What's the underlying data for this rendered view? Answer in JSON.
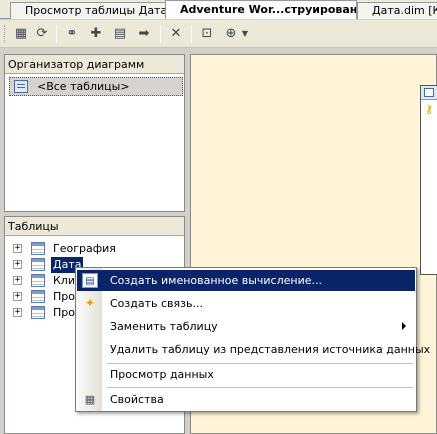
{
  "tabs": [
    {
      "label": "Просмотр таблицы Дата"
    },
    {
      "label": "Adventure Wor...струирование]"
    },
    {
      "label": "Дата.dim [Ко"
    }
  ],
  "diagram_pane": {
    "title": "Организатор диаграмм",
    "item": "<Все таблицы>"
  },
  "tables_pane": {
    "title": "Таблицы",
    "rows": [
      {
        "label": "География"
      },
      {
        "label": "Дата"
      },
      {
        "label": "Клие"
      },
      {
        "label": "Прод"
      },
      {
        "label": "Прод"
      }
    ]
  },
  "context_menu": {
    "items": [
      {
        "label": "Создать именованное вычисление..."
      },
      {
        "label": "Создать связь..."
      },
      {
        "label": "Заменить таблицу"
      },
      {
        "label": "Удалить таблицу из представления источника данных"
      },
      {
        "label": "Просмотр данных"
      },
      {
        "label": "Свойства"
      }
    ]
  },
  "colors": {
    "highlight": "#0a246a",
    "canvas": "#fff4d7"
  }
}
